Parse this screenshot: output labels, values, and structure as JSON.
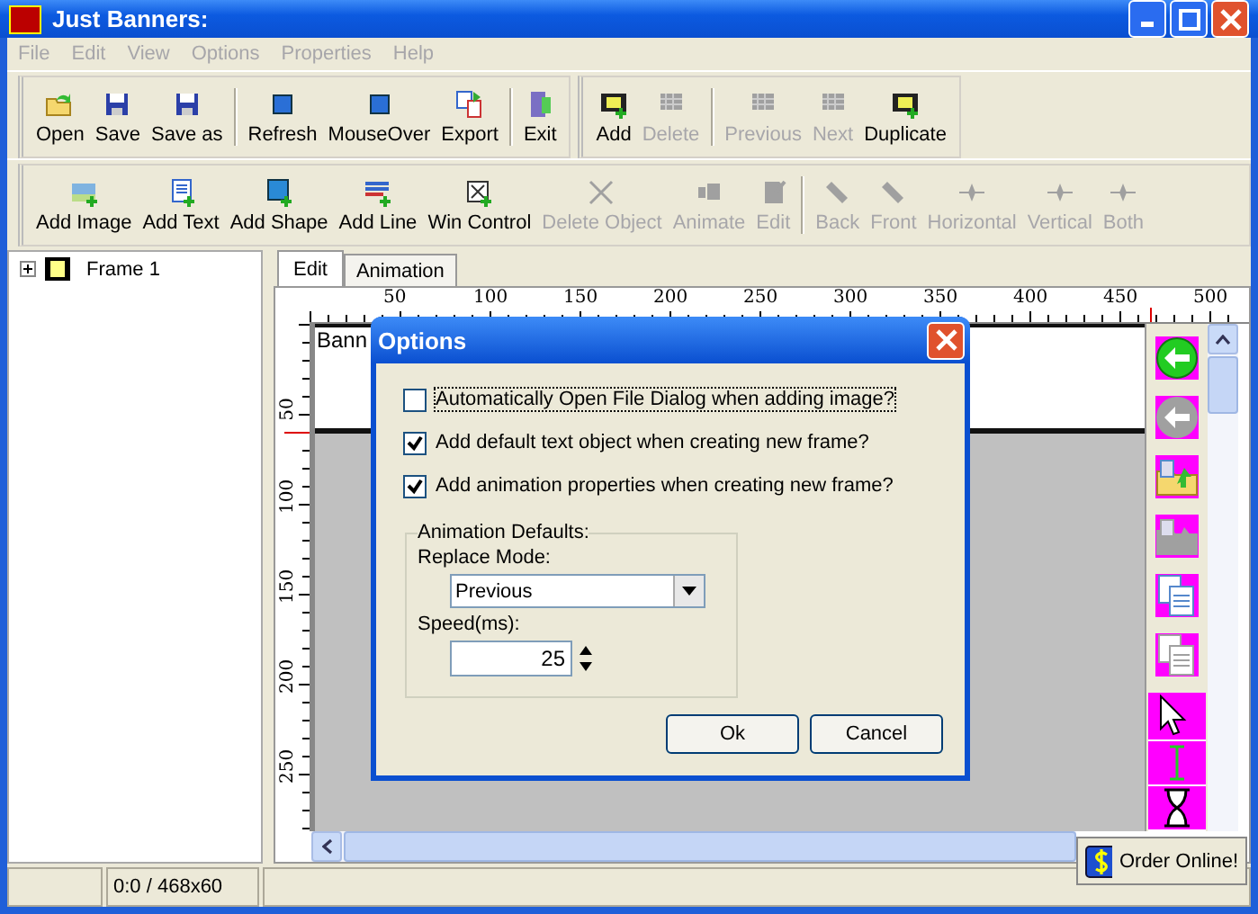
{
  "window": {
    "title": "Just Banners:"
  },
  "menu": [
    {
      "label": "File",
      "disabled": true
    },
    {
      "label": "Edit",
      "disabled": true
    },
    {
      "label": "View",
      "disabled": true
    },
    {
      "label": "Options",
      "disabled": true
    },
    {
      "label": "Properties",
      "disabled": true
    },
    {
      "label": "Help",
      "disabled": true
    }
  ],
  "toolbar_1": [
    [
      {
        "label": "Open",
        "disabled": false
      },
      {
        "label": "Save",
        "disabled": false
      },
      {
        "label": "Save as",
        "disabled": false
      }
    ],
    [
      {
        "label": "Refresh",
        "disabled": false
      },
      {
        "label": "MouseOver",
        "disabled": false
      },
      {
        "label": "Export",
        "disabled": false
      }
    ],
    [
      {
        "label": "Exit",
        "disabled": false
      }
    ]
  ],
  "toolbar_frames": [
    [
      {
        "label": "Add",
        "disabled": false
      },
      {
        "label": "Delete",
        "disabled": true
      }
    ],
    [
      {
        "label": "Previous",
        "disabled": true
      },
      {
        "label": "Next",
        "disabled": true
      },
      {
        "label": "Duplicate",
        "disabled": false
      }
    ]
  ],
  "toolbar_2": [
    [
      {
        "label": "Add Image",
        "disabled": false
      },
      {
        "label": "Add Text",
        "disabled": false
      },
      {
        "label": "Add Shape",
        "disabled": false
      },
      {
        "label": "Add Line",
        "disabled": false
      },
      {
        "label": "Win Control",
        "disabled": false
      },
      {
        "label": "Delete Object",
        "disabled": true
      },
      {
        "label": "Animate",
        "disabled": true
      },
      {
        "label": "Edit",
        "disabled": true
      }
    ],
    [
      {
        "label": "Back",
        "disabled": true
      },
      {
        "label": "Front",
        "disabled": true
      },
      {
        "label": "Horizontal",
        "disabled": true
      },
      {
        "label": "Vertical",
        "disabled": true
      },
      {
        "label": "Both",
        "disabled": true
      }
    ]
  ],
  "tree": [
    {
      "label": "Frame 1",
      "expanded": false
    }
  ],
  "tabs": [
    {
      "label": "Edit",
      "selected": true
    },
    {
      "label": "Animation",
      "selected": false
    }
  ],
  "ruler": {
    "x_labels": [
      "50",
      "100",
      "150",
      "200",
      "250",
      "300",
      "350",
      "400",
      "450",
      "500"
    ],
    "y_labels": [
      "50",
      "100",
      "150",
      "200",
      "250"
    ]
  },
  "banner": {
    "text": "Bann"
  },
  "palette": [
    {
      "disabled": false
    },
    {
      "disabled": true
    },
    {
      "disabled": false
    },
    {
      "disabled": true
    },
    {
      "disabled": false
    },
    {
      "disabled": true
    }
  ],
  "dialog": {
    "title": "Options",
    "checkboxes": [
      {
        "label": "Automatically Open File Dialog when adding image?",
        "checked": false
      },
      {
        "label": "Add default text object when creating new frame?",
        "checked": true
      },
      {
        "label": "Add animation properties when creating new frame?",
        "checked": true
      }
    ],
    "group": "Animation Defaults:",
    "replace_label": "Replace Mode:",
    "replace_value": "Previous",
    "speed_label": "Speed(ms):",
    "speed_value": "25",
    "buttons": [
      "Ok",
      "Cancel"
    ]
  },
  "order_button": "Order Online!",
  "status_bar": {
    "position": "0:0 / 468x60"
  }
}
